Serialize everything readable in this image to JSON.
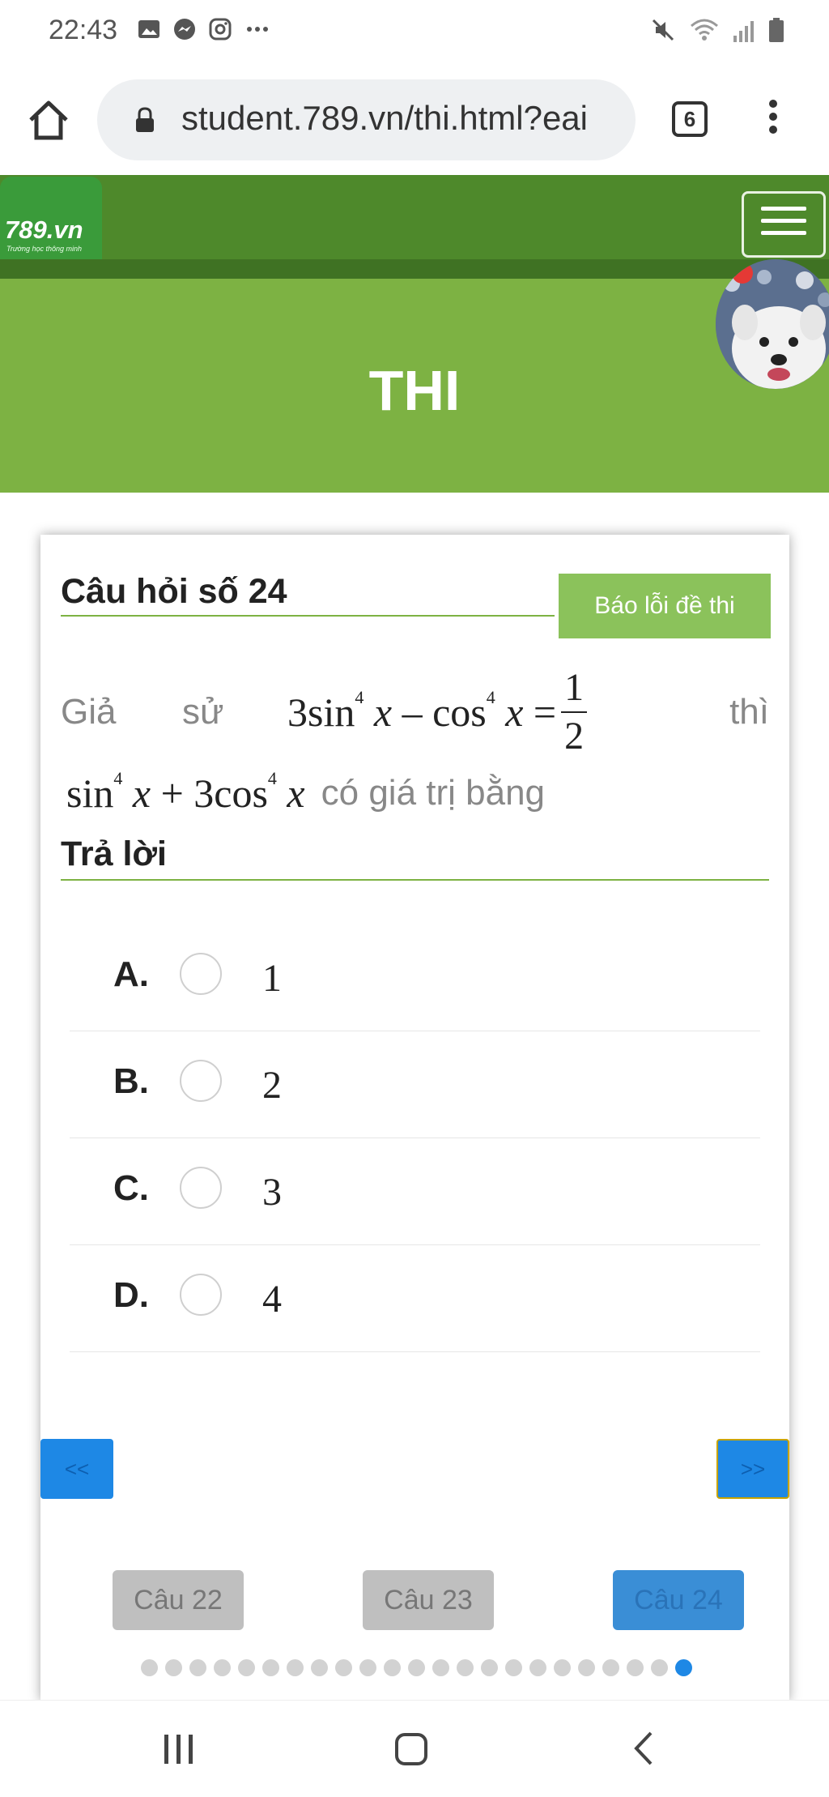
{
  "status_bar": {
    "time": "22:43"
  },
  "browser": {
    "url": "student.789.vn/thi.html?eai",
    "tab_count": "6"
  },
  "site": {
    "logo_text": "789.vn",
    "logo_tagline": "Trường học thông minh",
    "banner_title": "THI"
  },
  "question": {
    "heading": "Câu hỏi số 24",
    "report_button": "Báo lỗi đề thi",
    "word_gia": "Giả",
    "word_su": "sử",
    "eq_left_coef": "3",
    "eq_fraction_num": "1",
    "eq_fraction_den": "2",
    "word_thi": "thì",
    "eq2_coef": "3",
    "tail_text": "có giá trị bằng"
  },
  "answer_heading": "Trả lời",
  "options": [
    {
      "label": "A.",
      "value": "1"
    },
    {
      "label": "B.",
      "value": "2"
    },
    {
      "label": "C.",
      "value": "3"
    },
    {
      "label": "D.",
      "value": "4"
    }
  ],
  "nav": {
    "prev": "<<",
    "next": ">>"
  },
  "question_buttons": [
    "Câu 22",
    "Câu 23",
    "Câu 24"
  ],
  "colors": {
    "header_green": "#4e892b",
    "banner_green": "#7db243",
    "accent_blue": "#1e88e5",
    "report_green": "#8bc25b"
  },
  "progress": {
    "total_questions": 23,
    "current_index": 22
  }
}
